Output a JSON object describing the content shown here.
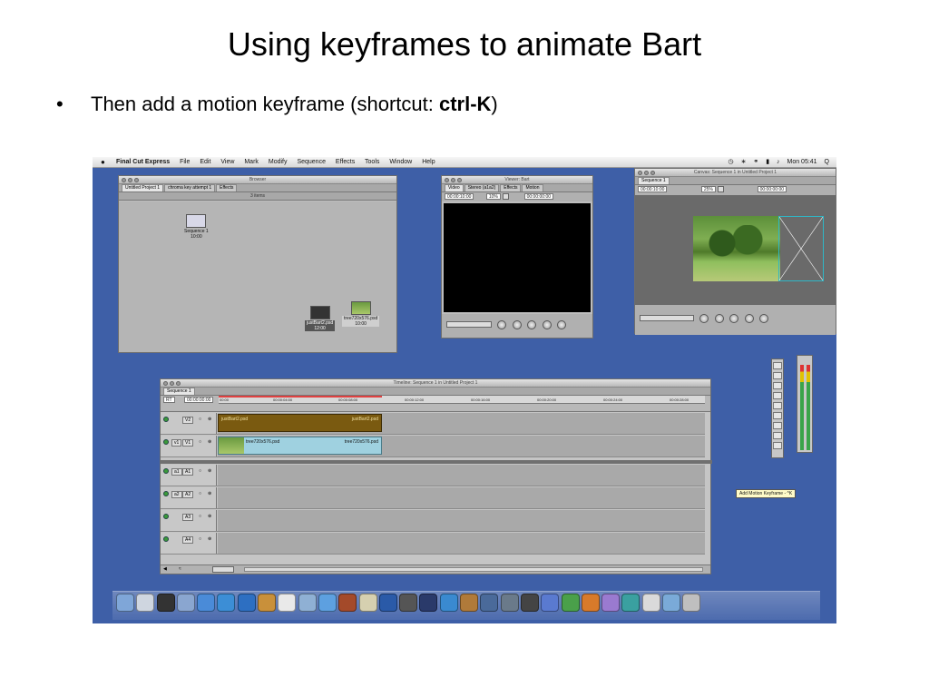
{
  "slide": {
    "title": "Using keyframes to animate Bart",
    "bullet": "•",
    "line_prefix": "Then add a motion keyframe (shortcut: ",
    "line_shortcut": "ctrl-K",
    "line_suffix": ")"
  },
  "menubar": {
    "apple": "",
    "app_name": "Final Cut Express",
    "menus": [
      "File",
      "Edit",
      "View",
      "Mark",
      "Modify",
      "Sequence",
      "Effects",
      "Tools",
      "Window",
      "Help"
    ],
    "clock": "Mon 05:41",
    "search_icon": "Q"
  },
  "browser": {
    "title": "Browser",
    "tabs": [
      "Untitled Project 1",
      "chroma key attempt 1",
      "Effects"
    ],
    "item_count": "3 items",
    "items": [
      {
        "name": "Sequence 1",
        "duration": "10:00",
        "selected": false
      },
      {
        "name": "justBart2.psd",
        "duration": "12:00",
        "selected": true
      },
      {
        "name": "tree720x576.psd",
        "duration": "10:00",
        "selected": false
      }
    ]
  },
  "viewer": {
    "title": "Viewer: Bart",
    "tabs": [
      "Video",
      "Stereo (a1a2)",
      "Effects",
      "Motion"
    ],
    "timecode_left": "00:00:10:00",
    "zoom": "10%",
    "timecode_right": "00:00:00:00"
  },
  "canvas": {
    "title": "Canvas: Sequence 1 in Untitled Project 1",
    "tab": "Sequence 1",
    "timecode_left": "00:00:10:00",
    "zoom": "25%",
    "timecode_right": "00:00:00:00",
    "tooltip": "Add Motion Keyframe - ^K"
  },
  "timeline": {
    "title": "Timeline: Sequence 1 in Untitled Project 1",
    "tab": "Sequence 1",
    "rt": "RT",
    "current_timecode": "00:00:00:00",
    "ruler": [
      "00:00",
      "00:00:04:00",
      "00:00:08:00",
      "00:00:12:00",
      "00:00:16:00",
      "00:00:20:00",
      "00:00:24:00",
      "00:00:28:00"
    ],
    "video_tracks": [
      {
        "source": "",
        "name": "V2",
        "clip_start": "justBart2.psd",
        "clip_end": "justBart2.psd"
      },
      {
        "source": "v1",
        "name": "V1",
        "clip_start": "tree720x576.psd",
        "clip_end": "tree720x576.psd"
      }
    ],
    "audio_tracks": [
      {
        "source": "a1",
        "name": "A1"
      },
      {
        "source": "a2",
        "name": "A2"
      },
      {
        "source": "",
        "name": "A3"
      },
      {
        "source": "",
        "name": "A4"
      }
    ]
  },
  "colors": {
    "desktop": "#3e5fa7",
    "clip_video_gold": "#7a5a10",
    "clip_video_blue": "#9fd1e0",
    "bounding_box": "#2fb7c7",
    "tooltip_bg": "#fffbc8"
  },
  "dock": {
    "icons": [
      "finder-icon",
      "preview-icon",
      "dashboard-icon",
      "mail-icon",
      "safari-icon",
      "ichat-icon",
      "isync-icon",
      "address-book-icon",
      "ical-icon",
      "iphoto-icon",
      "itunes-icon",
      "imovie-icon",
      "aperture-icon",
      "photoshop-icon",
      "final-cut-icon",
      "after-effects-icon",
      "quicktime-icon",
      "garageband-icon",
      "expose-icon",
      "system-prefs-icon",
      "terminal-icon",
      "word-icon",
      "excel-icon",
      "powerpoint-icon",
      "messenger-icon",
      "stickies-icon",
      "documents-icon",
      "folder-icon",
      "trash-icon"
    ]
  }
}
